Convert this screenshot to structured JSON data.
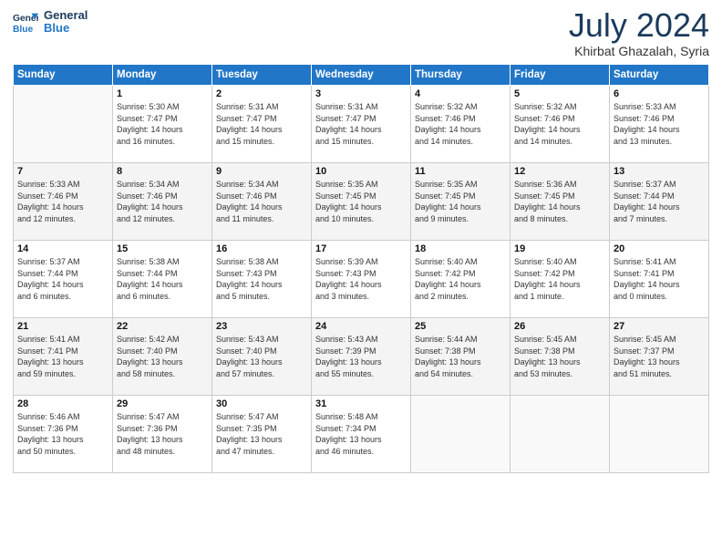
{
  "header": {
    "logo_line1": "General",
    "logo_line2": "Blue",
    "month": "July 2024",
    "location": "Khirbat Ghazalah, Syria"
  },
  "weekdays": [
    "Sunday",
    "Monday",
    "Tuesday",
    "Wednesday",
    "Thursday",
    "Friday",
    "Saturday"
  ],
  "weeks": [
    [
      {
        "day": "",
        "text": ""
      },
      {
        "day": "1",
        "text": "Sunrise: 5:30 AM\nSunset: 7:47 PM\nDaylight: 14 hours\nand 16 minutes."
      },
      {
        "day": "2",
        "text": "Sunrise: 5:31 AM\nSunset: 7:47 PM\nDaylight: 14 hours\nand 15 minutes."
      },
      {
        "day": "3",
        "text": "Sunrise: 5:31 AM\nSunset: 7:47 PM\nDaylight: 14 hours\nand 15 minutes."
      },
      {
        "day": "4",
        "text": "Sunrise: 5:32 AM\nSunset: 7:46 PM\nDaylight: 14 hours\nand 14 minutes."
      },
      {
        "day": "5",
        "text": "Sunrise: 5:32 AM\nSunset: 7:46 PM\nDaylight: 14 hours\nand 14 minutes."
      },
      {
        "day": "6",
        "text": "Sunrise: 5:33 AM\nSunset: 7:46 PM\nDaylight: 14 hours\nand 13 minutes."
      }
    ],
    [
      {
        "day": "7",
        "text": "Sunrise: 5:33 AM\nSunset: 7:46 PM\nDaylight: 14 hours\nand 12 minutes."
      },
      {
        "day": "8",
        "text": "Sunrise: 5:34 AM\nSunset: 7:46 PM\nDaylight: 14 hours\nand 12 minutes."
      },
      {
        "day": "9",
        "text": "Sunrise: 5:34 AM\nSunset: 7:46 PM\nDaylight: 14 hours\nand 11 minutes."
      },
      {
        "day": "10",
        "text": "Sunrise: 5:35 AM\nSunset: 7:45 PM\nDaylight: 14 hours\nand 10 minutes."
      },
      {
        "day": "11",
        "text": "Sunrise: 5:35 AM\nSunset: 7:45 PM\nDaylight: 14 hours\nand 9 minutes."
      },
      {
        "day": "12",
        "text": "Sunrise: 5:36 AM\nSunset: 7:45 PM\nDaylight: 14 hours\nand 8 minutes."
      },
      {
        "day": "13",
        "text": "Sunrise: 5:37 AM\nSunset: 7:44 PM\nDaylight: 14 hours\nand 7 minutes."
      }
    ],
    [
      {
        "day": "14",
        "text": "Sunrise: 5:37 AM\nSunset: 7:44 PM\nDaylight: 14 hours\nand 6 minutes."
      },
      {
        "day": "15",
        "text": "Sunrise: 5:38 AM\nSunset: 7:44 PM\nDaylight: 14 hours\nand 6 minutes."
      },
      {
        "day": "16",
        "text": "Sunrise: 5:38 AM\nSunset: 7:43 PM\nDaylight: 14 hours\nand 5 minutes."
      },
      {
        "day": "17",
        "text": "Sunrise: 5:39 AM\nSunset: 7:43 PM\nDaylight: 14 hours\nand 3 minutes."
      },
      {
        "day": "18",
        "text": "Sunrise: 5:40 AM\nSunset: 7:42 PM\nDaylight: 14 hours\nand 2 minutes."
      },
      {
        "day": "19",
        "text": "Sunrise: 5:40 AM\nSunset: 7:42 PM\nDaylight: 14 hours\nand 1 minute."
      },
      {
        "day": "20",
        "text": "Sunrise: 5:41 AM\nSunset: 7:41 PM\nDaylight: 14 hours\nand 0 minutes."
      }
    ],
    [
      {
        "day": "21",
        "text": "Sunrise: 5:41 AM\nSunset: 7:41 PM\nDaylight: 13 hours\nand 59 minutes."
      },
      {
        "day": "22",
        "text": "Sunrise: 5:42 AM\nSunset: 7:40 PM\nDaylight: 13 hours\nand 58 minutes."
      },
      {
        "day": "23",
        "text": "Sunrise: 5:43 AM\nSunset: 7:40 PM\nDaylight: 13 hours\nand 57 minutes."
      },
      {
        "day": "24",
        "text": "Sunrise: 5:43 AM\nSunset: 7:39 PM\nDaylight: 13 hours\nand 55 minutes."
      },
      {
        "day": "25",
        "text": "Sunrise: 5:44 AM\nSunset: 7:38 PM\nDaylight: 13 hours\nand 54 minutes."
      },
      {
        "day": "26",
        "text": "Sunrise: 5:45 AM\nSunset: 7:38 PM\nDaylight: 13 hours\nand 53 minutes."
      },
      {
        "day": "27",
        "text": "Sunrise: 5:45 AM\nSunset: 7:37 PM\nDaylight: 13 hours\nand 51 minutes."
      }
    ],
    [
      {
        "day": "28",
        "text": "Sunrise: 5:46 AM\nSunset: 7:36 PM\nDaylight: 13 hours\nand 50 minutes."
      },
      {
        "day": "29",
        "text": "Sunrise: 5:47 AM\nSunset: 7:36 PM\nDaylight: 13 hours\nand 48 minutes."
      },
      {
        "day": "30",
        "text": "Sunrise: 5:47 AM\nSunset: 7:35 PM\nDaylight: 13 hours\nand 47 minutes."
      },
      {
        "day": "31",
        "text": "Sunrise: 5:48 AM\nSunset: 7:34 PM\nDaylight: 13 hours\nand 46 minutes."
      },
      {
        "day": "",
        "text": ""
      },
      {
        "day": "",
        "text": ""
      },
      {
        "day": "",
        "text": ""
      }
    ]
  ]
}
